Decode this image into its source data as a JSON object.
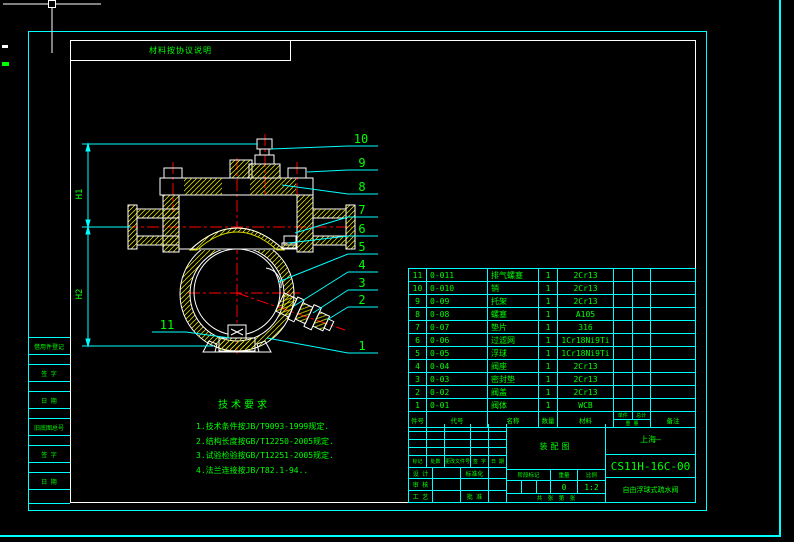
{
  "colors": {
    "line_green": "#00ff00",
    "line_cyan": "#00ffff",
    "line_red": "#ff0000",
    "hatch_yellow": "#d9d900",
    "line_white": "#ffffff"
  },
  "sheet": {
    "note_box": "材料按协议说明",
    "margin_cells": [
      "借用件登记",
      "",
      "签 字",
      "",
      "日 期",
      "",
      "旧底图总号",
      "",
      "签 字",
      "",
      "日 期",
      ""
    ]
  },
  "drawing": {
    "balloons": [
      "10",
      "9",
      "8",
      "7",
      "6",
      "5",
      "4",
      "3",
      "2",
      "1",
      "11"
    ],
    "dim_labels": {
      "h1": "H1",
      "h2": "H2"
    }
  },
  "tech_req": {
    "title": "技术要求",
    "items": [
      "1.技术条件按JB/T9093-1999规定.",
      "2.结构长度按GB/T12250-2005规定.",
      "3.试验检验按GB/T12251-2005规定.",
      "4.法兰连接按JB/T82.1-94.."
    ]
  },
  "parts_list": {
    "headers": {
      "no": "件号",
      "code": "代号",
      "name": "名称",
      "qty": "数量",
      "material": "材料",
      "unit": "单件",
      "total": "总计",
      "weight": "重 量",
      "remark": "备注"
    },
    "rows": [
      {
        "no": "11",
        "code": "0-011",
        "name": "排气螺塞",
        "qty": "1",
        "material": "2Cr13"
      },
      {
        "no": "10",
        "code": "0-010",
        "name": "销",
        "qty": "1",
        "material": "2Cr13"
      },
      {
        "no": "9",
        "code": "0-09",
        "name": "托架",
        "qty": "1",
        "material": "2Cr13"
      },
      {
        "no": "8",
        "code": "0-08",
        "name": "螺塞",
        "qty": "1",
        "material": "A105"
      },
      {
        "no": "7",
        "code": "0-07",
        "name": "垫片",
        "qty": "1",
        "material": "316"
      },
      {
        "no": "6",
        "code": "0-06",
        "name": "过滤网",
        "qty": "1",
        "material": "1Cr18Ni9Ti"
      },
      {
        "no": "5",
        "code": "0-05",
        "name": "浮球",
        "qty": "1",
        "material": "1Cr18Ni9Ti"
      },
      {
        "no": "4",
        "code": "0-04",
        "name": "阀座",
        "qty": "1",
        "material": "2Cr13"
      },
      {
        "no": "3",
        "code": "0-03",
        "name": "密封垫",
        "qty": "1",
        "material": "2Cr13"
      },
      {
        "no": "2",
        "code": "0-02",
        "name": "阀盖",
        "qty": "1",
        "material": "2Cr13"
      },
      {
        "no": "1",
        "code": "0-01",
        "name": "阀体",
        "qty": "1",
        "material": "WCB"
      }
    ]
  },
  "title_block": {
    "revision_header": [
      "标记",
      "处数",
      "更改文件号",
      "签 字",
      "日 期"
    ],
    "sign_rows": [
      {
        "left": "设 计",
        "right": "标准化"
      },
      {
        "left": "审 核",
        "right": ""
      },
      {
        "left": "工 艺",
        "right": "批 准"
      }
    ],
    "view_label": "装配图",
    "stage_label": "阶段标记",
    "weight_label": "重量",
    "scale_label": "比例",
    "weight_value": "0",
    "scale_value": "1:2",
    "sheets_label": "共　张　第　张",
    "company": "上海—",
    "drawing_number": "CS11H-16C-00",
    "product_name": "自由浮球式疏水阀"
  }
}
